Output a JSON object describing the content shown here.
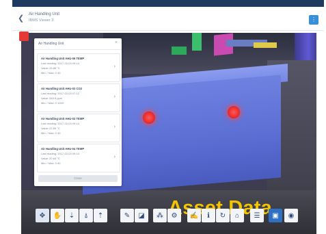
{
  "header": {
    "title": "Air Handling Unit",
    "subtitle": "IBMS Viewer 3",
    "menu_icon": "menu-icon"
  },
  "panel": {
    "title": "Air Handling Unit",
    "close_glyph": "×",
    "cards": [
      {
        "name": "Air Handling Unit AHU-06 TEMP",
        "line1": "Last reading: 2017-02-03 09:14",
        "line2": "Value: 25.86 °C",
        "line3": "Min: / Max: 0 40"
      },
      {
        "name": "Air Handling Unit AHU-02 CO2",
        "line1": "Last reading: 2017-02-03 07:12",
        "line2": "Value: 549.6 ppm",
        "line3": "Min: / Max: 0 1000"
      },
      {
        "name": "Air Handling Unit AHU-03 TEMP",
        "line1": "Last reading: 2017-02-03 09:14",
        "line2": "Value: 22.89 °C",
        "line3": "Min: / Max: 0 40"
      },
      {
        "name": "Air Handling Unit AHU-04 TEMP",
        "line1": "Last reading: 2017-02-03 09:14",
        "line2": "Value: 20.64 °C",
        "line3": "Min: / Max: 0 40"
      }
    ],
    "button_label": "Close"
  },
  "overlay": {
    "asset_label": "Asset Data"
  },
  "toolbar": {
    "tools": [
      {
        "name": "orbit-icon",
        "glyph": "✥"
      },
      {
        "name": "pan-icon",
        "glyph": "✋"
      },
      {
        "name": "zoom-icon",
        "glyph": "⇣"
      },
      {
        "name": "walk-icon",
        "glyph": "⍋"
      },
      {
        "name": "first-person-icon",
        "glyph": "⇡"
      },
      {
        "name": "measure-icon",
        "glyph": "✎"
      },
      {
        "name": "section-icon",
        "glyph": "◪"
      },
      {
        "name": "model-tree-icon",
        "glyph": "⁂"
      },
      {
        "name": "settings-icon",
        "glyph": "⚙"
      },
      {
        "name": "markup-icon",
        "glyph": "✍"
      },
      {
        "name": "properties-icon",
        "glyph": "ℹ"
      },
      {
        "name": "refresh-icon",
        "glyph": "↻"
      },
      {
        "name": "camera-icon",
        "glyph": "⌂"
      },
      {
        "name": "list-icon",
        "glyph": "☰"
      },
      {
        "name": "save-icon",
        "glyph": "▣"
      },
      {
        "name": "eye-icon",
        "glyph": "◉"
      }
    ]
  },
  "colors": {
    "accent": "#2f6fc4",
    "alarm": "#e53935",
    "label": "#f5c400",
    "duct": "#6172d8"
  }
}
